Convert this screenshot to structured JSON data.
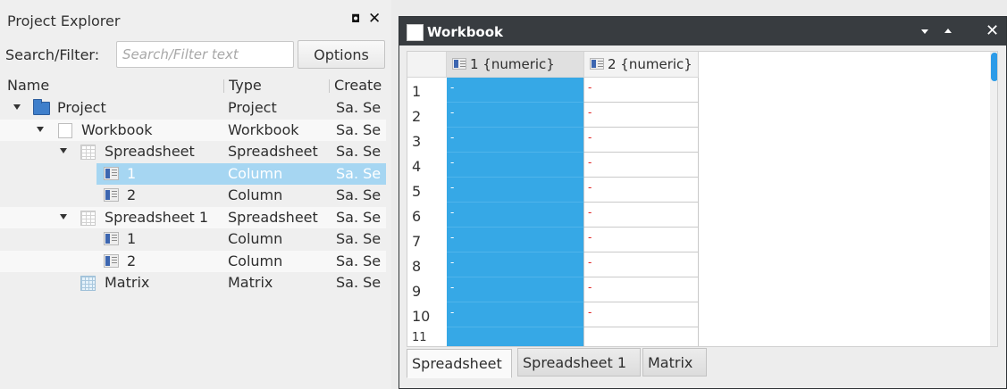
{
  "explorer": {
    "title": "Project Explorer",
    "filter_label": "Search/Filter:",
    "filter_placeholder": "Search/Filter text",
    "options_label": "Options",
    "columns": {
      "name": "Name",
      "type": "Type",
      "created": "Create"
    },
    "rows": [
      {
        "name": "Project",
        "type": "Project",
        "created": "Sa. Se",
        "icon": "folder-icon"
      },
      {
        "name": "Workbook",
        "type": "Workbook",
        "created": "Sa. Se",
        "icon": "workbook-icon"
      },
      {
        "name": "Spreadsheet",
        "type": "Spreadsheet",
        "created": "Sa. Se",
        "icon": "spreadsheet-icon"
      },
      {
        "name": "1",
        "type": "Column",
        "created": "Sa. Se",
        "icon": "column-icon",
        "selected": true
      },
      {
        "name": "2",
        "type": "Column",
        "created": "Sa. Se",
        "icon": "column-icon"
      },
      {
        "name": "Spreadsheet 1",
        "type": "Spreadsheet",
        "created": "Sa. Se",
        "icon": "spreadsheet-icon"
      },
      {
        "name": "1",
        "type": "Column",
        "created": "Sa. Se",
        "icon": "column-icon"
      },
      {
        "name": "2",
        "type": "Column",
        "created": "Sa. Se",
        "icon": "column-icon"
      },
      {
        "name": "Matrix",
        "type": "Matrix",
        "created": "Sa. Se",
        "icon": "matrix-icon"
      }
    ]
  },
  "workbook": {
    "title": "Workbook",
    "columns": [
      "1 {numeric}",
      "2 {numeric}"
    ],
    "row_numbers": [
      "1",
      "2",
      "3",
      "4",
      "5",
      "6",
      "7",
      "8",
      "9",
      "10",
      "11"
    ],
    "cell_value": "-",
    "tabs": [
      "Spreadsheet",
      "Spreadsheet 1",
      "Matrix"
    ],
    "active_tab": "Spreadsheet"
  },
  "colors": {
    "selection": "#36a8e6",
    "tree_selection": "#a6d6f2",
    "titlebar": "#383c40",
    "missing_value": "#e02020"
  }
}
